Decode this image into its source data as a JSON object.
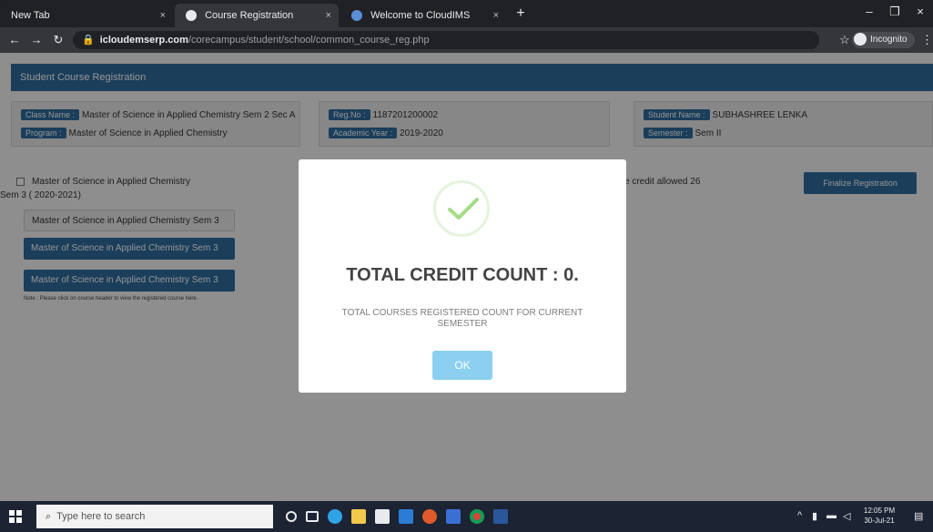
{
  "browser": {
    "tabs": [
      {
        "label": "New Tab",
        "active": false
      },
      {
        "label": "Course Registration",
        "active": true
      },
      {
        "label": "Welcome to CloudIMS",
        "active": false
      }
    ],
    "close_glyph": "×",
    "new_tab_glyph": "+",
    "address": {
      "host": "icloudemserp.com",
      "path": "/corecampus/student/school/common_course_reg.php"
    },
    "profile_label": "Incognito",
    "window_controls": {
      "minimize": "–",
      "maximize": "❐",
      "close": "×"
    },
    "nav": {
      "back": "←",
      "forward": "→",
      "reload": "↻"
    },
    "icons": {
      "lock": "lock-icon",
      "star": "star-icon",
      "menu": "kebab-menu-icon"
    }
  },
  "page": {
    "header_title": "Student Course Registration",
    "info_left": [
      {
        "label": "Class Name :",
        "value": "Master of Science in Applied Chemistry Sem 2 Sec A"
      },
      {
        "label": "Program :",
        "value": "Master of Science in Applied Chemistry"
      }
    ],
    "info_mid": [
      {
        "label": "Reg.No :",
        "value": "1187201200002"
      },
      {
        "label": "Academic Year :",
        "value": "2019-2020"
      }
    ],
    "info_right": [
      {
        "label": "Student Name :",
        "value": "SUBHASHREE LENKA"
      },
      {
        "label": "Semester :",
        "value": "Sem II"
      }
    ],
    "elective_label": "Master of Science in Applied Chemistry",
    "elective_sub": "Sem 3 ( 2020-2021)",
    "courses": [
      {
        "label": "Master of Science in Applied Chemistry Sem 3",
        "style": "plain"
      },
      {
        "label": "Master of Science in Applied Chemistry Sem 3",
        "style": "blue"
      },
      {
        "label": "Master of Science in Applied Chemistry Sem 3",
        "style": "blue"
      }
    ],
    "note": "Note : Please click on course header to view the registered course here.",
    "credit_info": "e credit allowed 26",
    "finalize_label": "Finalize Registration"
  },
  "modal": {
    "title": "TOTAL CREDIT COUNT : 0.",
    "message": "TOTAL COURSES REGISTERED COUNT FOR CURRENT SEMESTER",
    "ok_label": "OK",
    "icon": "success-check-icon",
    "accent": "#a5dc86"
  },
  "taskbar": {
    "search_placeholder": "Type here to search",
    "time": "12:05 PM",
    "date": "30-Jul-21"
  },
  "colors": {
    "brand_blue": "#2f6c9d",
    "ok_button": "#8dcff0",
    "taskbar": "#1c2333"
  }
}
